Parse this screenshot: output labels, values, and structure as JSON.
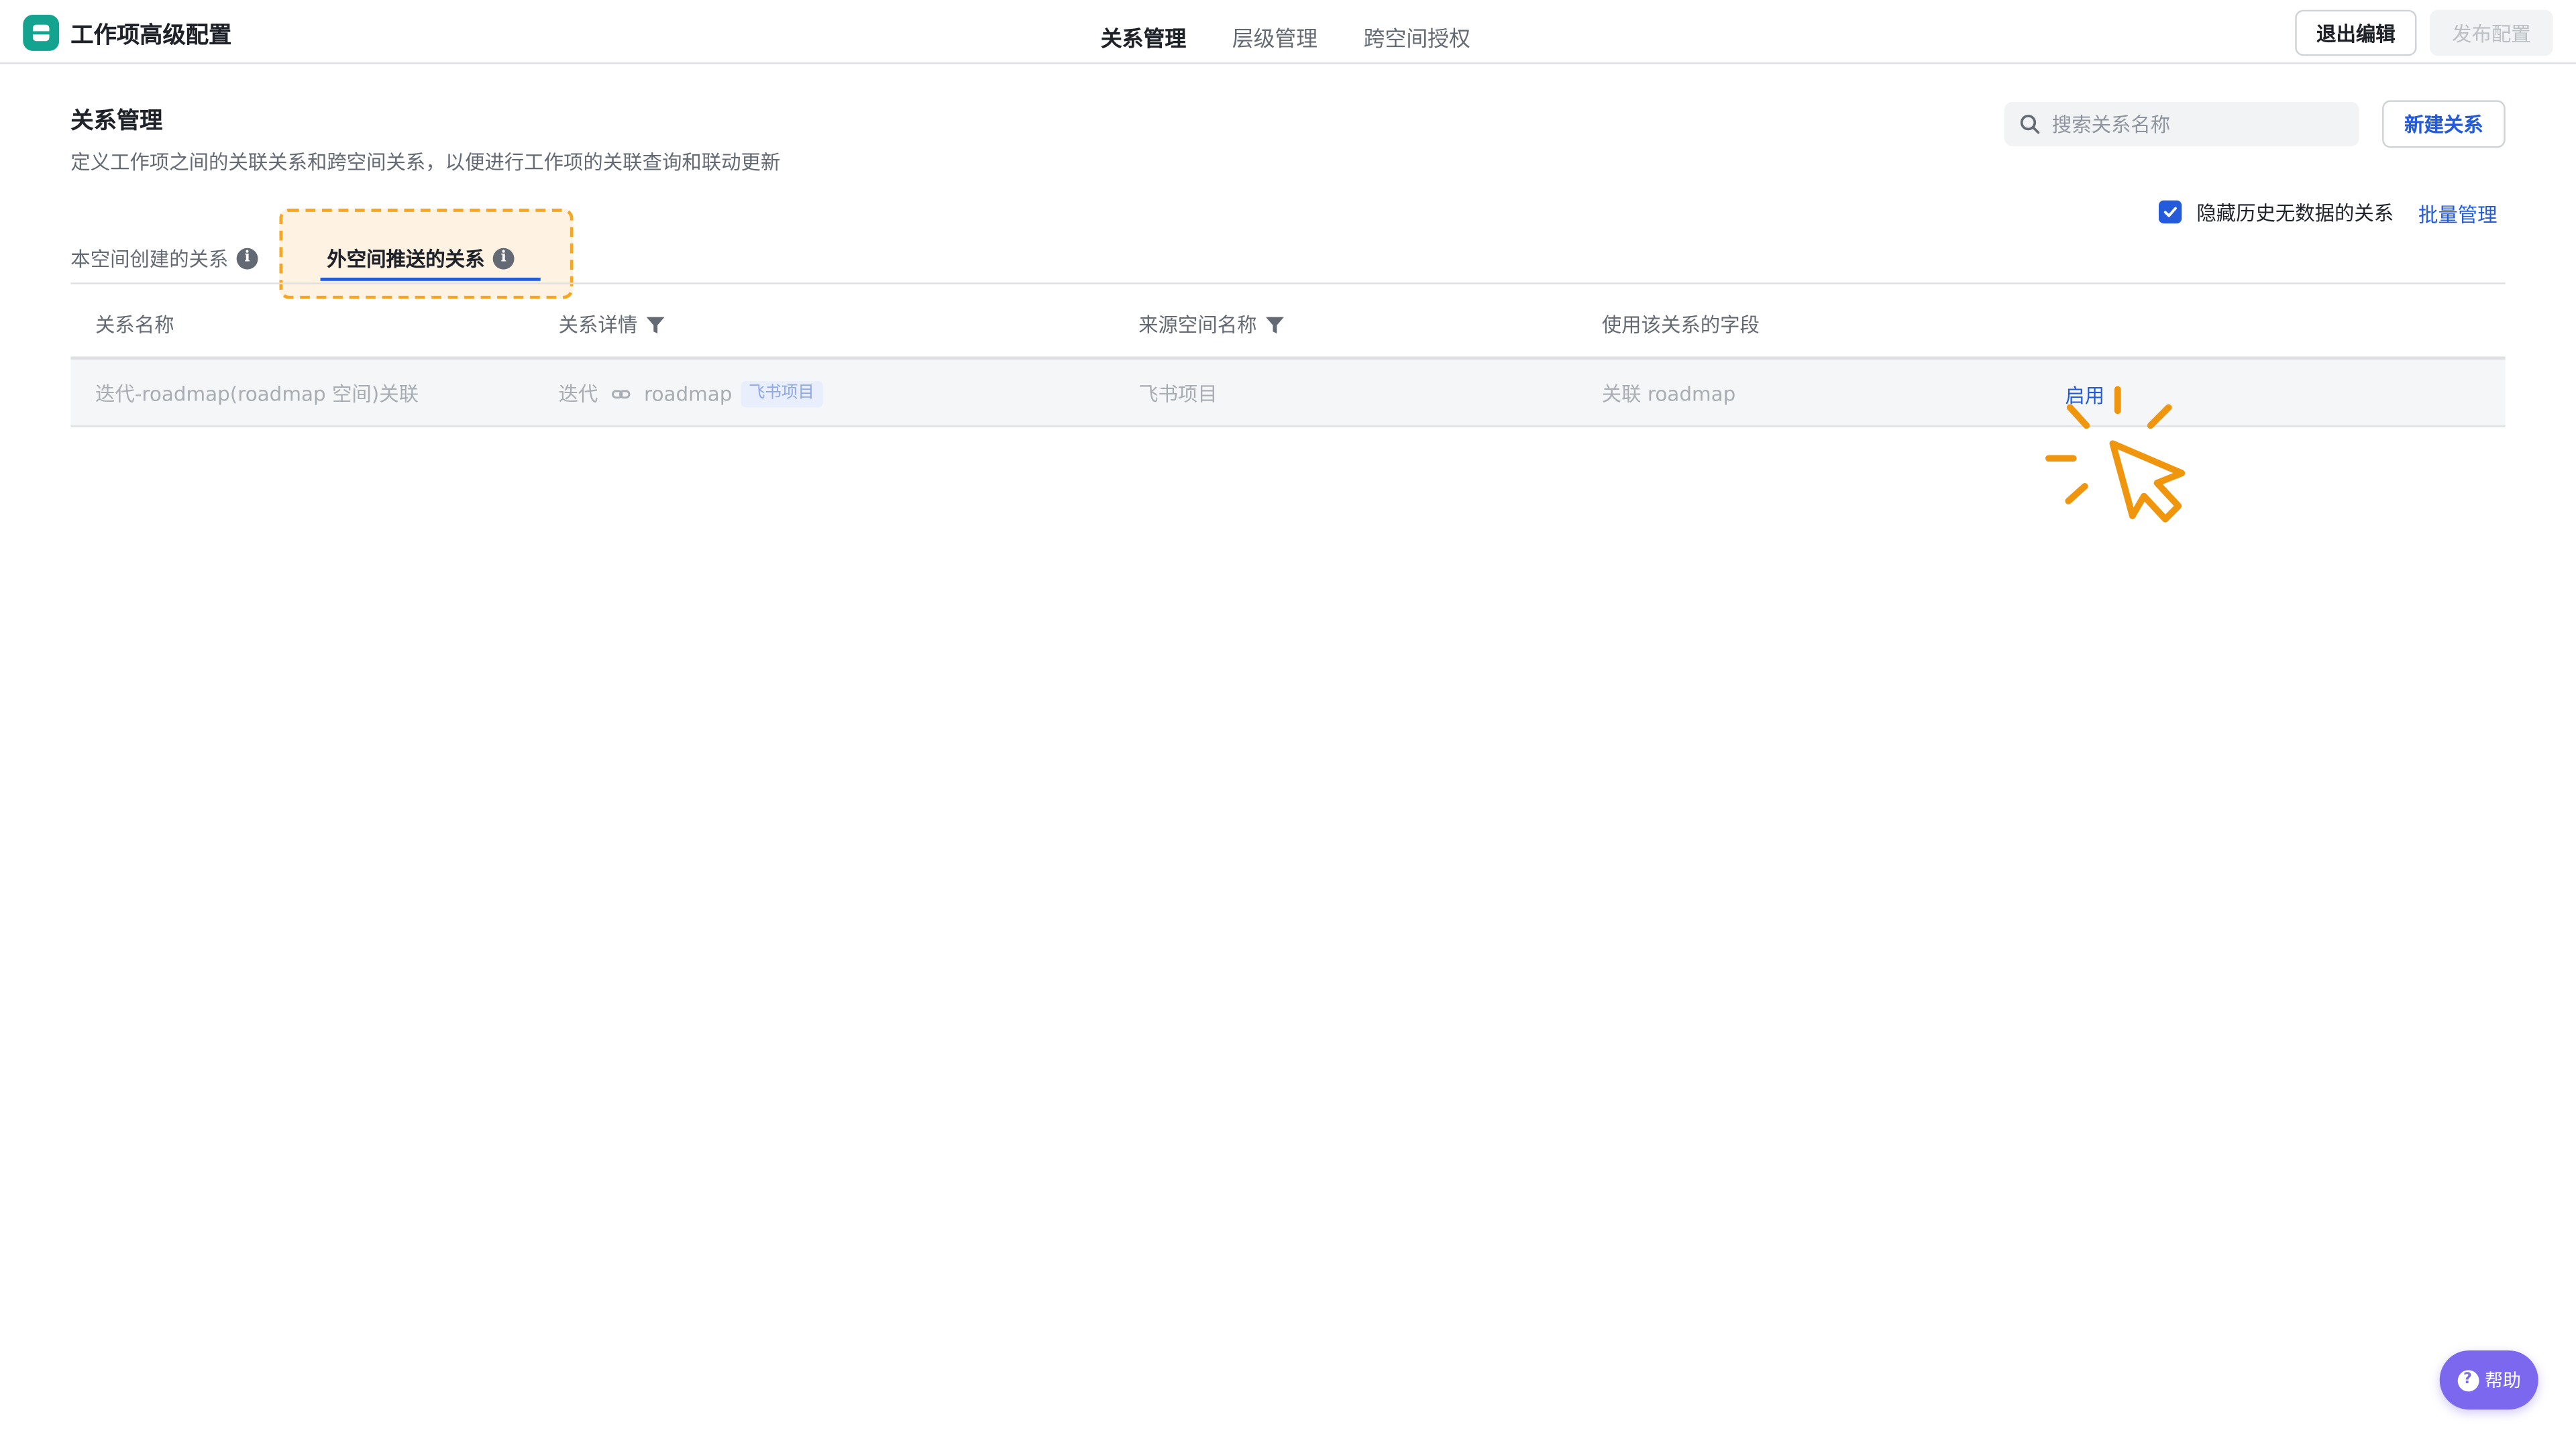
{
  "header": {
    "app_title": "工作项高级配置",
    "tabs": [
      {
        "label": "关系管理",
        "active": true
      },
      {
        "label": "层级管理",
        "active": false
      },
      {
        "label": "跨空间授权",
        "active": false
      }
    ],
    "exit_label": "退出编辑",
    "publish_label": "发布配置"
  },
  "page": {
    "title": "关系管理",
    "description": "定义工作项之间的关联关系和跨空间关系，以便进行工作项的关联查询和联动更新",
    "search_placeholder": "搜索关系名称",
    "new_button": "新建关系",
    "subtabs": [
      {
        "label": "本空间创建的关系",
        "active": false
      },
      {
        "label": "外空间推送的关系",
        "active": true
      }
    ],
    "hide_history_label": "隐藏历史无数据的关系",
    "hide_history_checked": true,
    "batch_manage": "批量管理"
  },
  "table": {
    "columns": [
      "关系名称",
      "关系详情",
      "来源空间名称",
      "使用该关系的字段"
    ],
    "rows": [
      {
        "name": "迭代-roadmap(roadmap 空间)关联",
        "detail_from": "迭代",
        "detail_to": "roadmap",
        "detail_tag": "飞书项目",
        "source_space": "飞书项目",
        "field": "关联 roadmap",
        "action": "启用"
      }
    ]
  },
  "help": {
    "label": "帮助"
  },
  "colors": {
    "accent": "#245bdb",
    "logo": "#13a38f",
    "highlight": "#f5a623",
    "help": "#7b68ee"
  },
  "icons": [
    "logo-icon",
    "search-icon",
    "info-icon",
    "checkbox-check-icon",
    "filter-icon",
    "link-icon",
    "click-cursor-icon",
    "question-icon"
  ]
}
